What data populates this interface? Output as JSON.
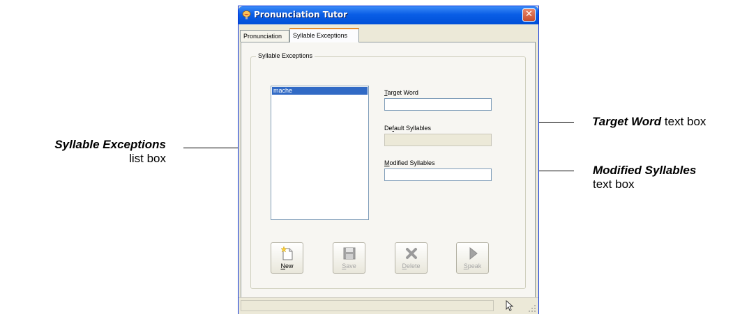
{
  "window": {
    "title": "Pronunciation Tutor",
    "close_glyph": "✕"
  },
  "tabs": [
    {
      "label": "Pronunciation",
      "active": false
    },
    {
      "label": "Syllable Exceptions",
      "active": true
    }
  ],
  "group": {
    "legend": "Syllable Exceptions"
  },
  "listbox": {
    "items": [
      {
        "label": "mache",
        "selected": true
      }
    ]
  },
  "fields": {
    "target_word": {
      "label_mnemonic": "T",
      "label_rest": "arget Word",
      "value": ""
    },
    "default_syllables": {
      "label_pre": "De",
      "label_mnemonic": "f",
      "label_rest": "ault Syllables",
      "value": "",
      "disabled": true
    },
    "modified_syllables": {
      "label_mnemonic": "M",
      "label_rest": "odified Syllables",
      "value": ""
    }
  },
  "buttons": [
    {
      "mnemonic": "N",
      "rest": "ew",
      "icon": "new-document-icon",
      "enabled": true
    },
    {
      "mnemonic": "S",
      "rest": "ave",
      "icon": "floppy-disk-icon",
      "enabled": false
    },
    {
      "mnemonic": "D",
      "rest": "elete",
      "icon": "red-x-icon",
      "enabled": false
    },
    {
      "mnemonic": "S",
      "rest": "peak",
      "icon": "play-triangle-icon",
      "enabled": false
    }
  ],
  "callouts": {
    "target_word": {
      "bold": "Target Word",
      "rest": " text box"
    },
    "syllable_exceptions": {
      "bold": "Syllable Exceptions",
      "rest": "list box"
    },
    "modified_syllables": {
      "bold": "Modified Syllables",
      "rest": "text box"
    }
  },
  "colors": {
    "titlebar": "#0a5ee6",
    "selection": "#316ac5",
    "close_button": "#c84f2f",
    "dialog_bg": "#ece9d8"
  }
}
